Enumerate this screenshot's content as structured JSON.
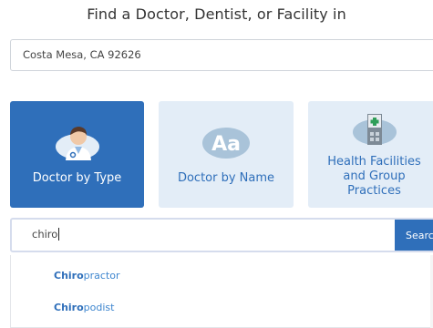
{
  "header": {
    "title": "Find a Doctor, Dentist, or Facility in"
  },
  "location": {
    "value": "Costa Mesa, CA 92626"
  },
  "cards": [
    {
      "label": "Doctor by Type",
      "icon": "doctor-icon",
      "active": true
    },
    {
      "label": "Doctor by Name",
      "icon": "name-icon",
      "active": false
    },
    {
      "label_lines": [
        "Health Facilities",
        "and Group",
        "Practices"
      ],
      "icon": "facility-icon",
      "active": false
    }
  ],
  "search": {
    "value": "chiro",
    "button_label": "Search"
  },
  "suggestions": [
    {
      "match": "Chiro",
      "rest": "practor"
    },
    {
      "match": "Chiro",
      "rest": "podist"
    }
  ],
  "colors": {
    "accent": "#2f6fba",
    "card_inactive_bg": "#e3edf7",
    "link": "#3e86cf"
  }
}
